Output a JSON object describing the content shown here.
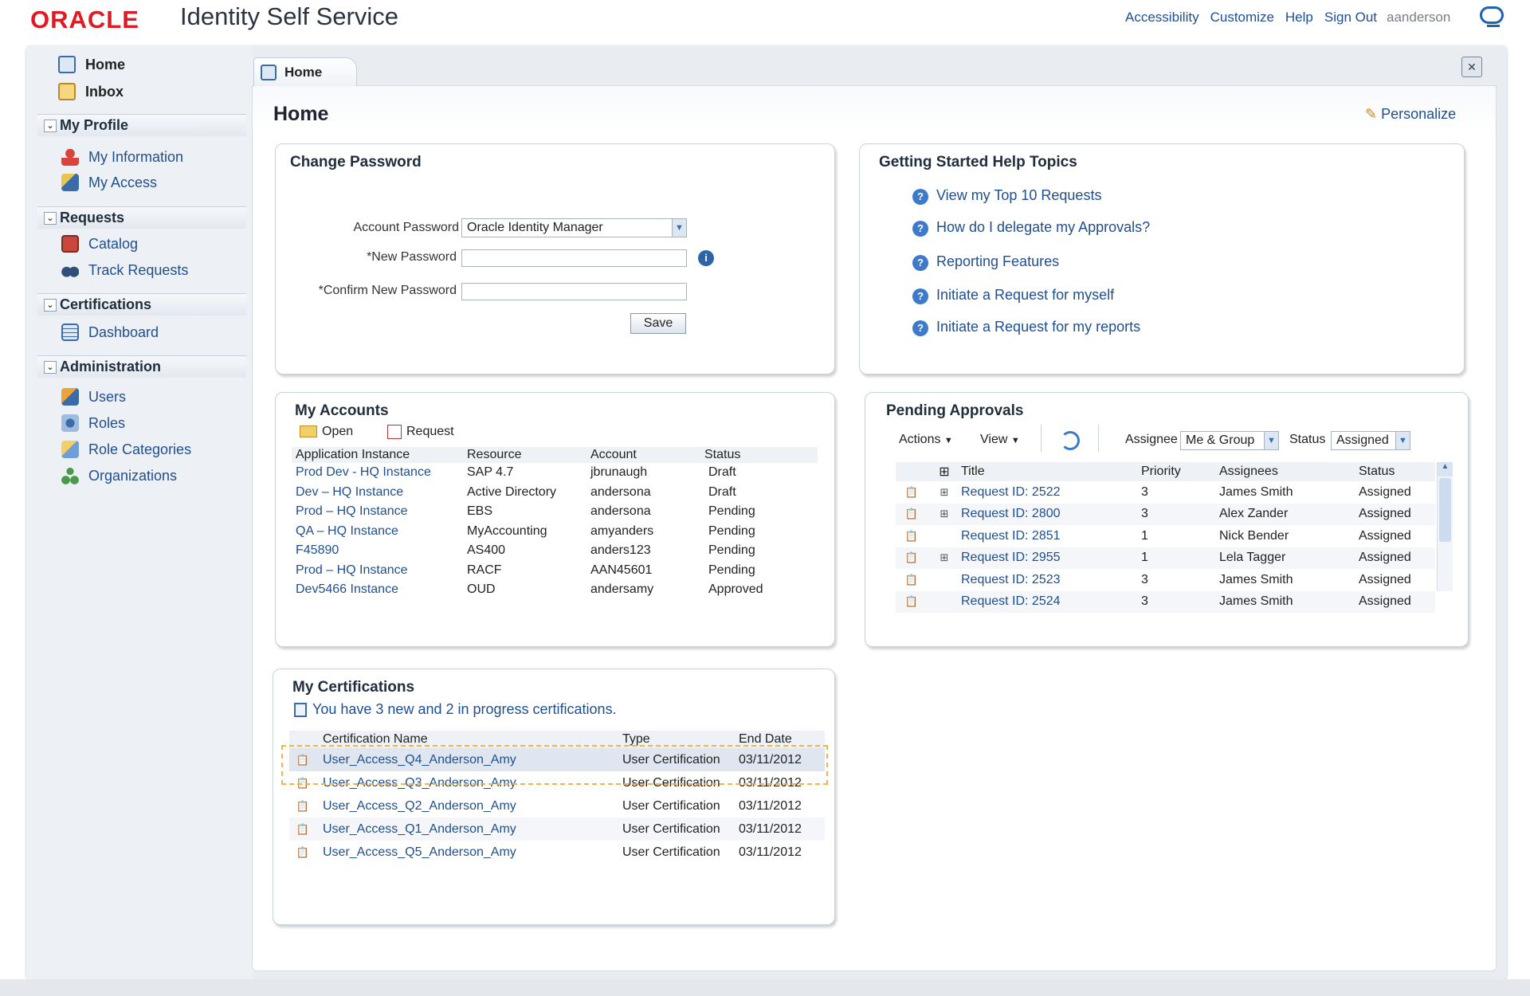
{
  "header": {
    "logo": "ORACLE",
    "app_title": "Identity Self Service",
    "links": [
      "Accessibility",
      "Customize",
      "Help",
      "Sign Out"
    ],
    "username": "aanderson"
  },
  "sidebar": {
    "home": "Home",
    "inbox": "Inbox",
    "sections": [
      {
        "title": "My Profile",
        "items": [
          "My Information",
          "My Access"
        ]
      },
      {
        "title": "Requests",
        "items": [
          "Catalog",
          "Track Requests"
        ]
      },
      {
        "title": "Certifications",
        "items": [
          "Dashboard"
        ]
      },
      {
        "title": "Administration",
        "items": [
          "Users",
          "Roles",
          "Role Categories",
          "Organizations"
        ]
      }
    ]
  },
  "tab": {
    "label": "Home"
  },
  "page": {
    "title": "Home",
    "personalize": "Personalize"
  },
  "change_password": {
    "title": "Change Password",
    "account_label": "Account Password",
    "account_value": "Oracle Identity Manager",
    "new_label": "*New Password",
    "confirm_label": "*Confirm New Password",
    "save": "Save"
  },
  "help_topics": {
    "title": "Getting Started Help Topics",
    "items": [
      "View my Top 10 Requests",
      "How do I delegate my Approvals?",
      "Reporting Features",
      "Initiate a Request for myself",
      "Initiate a Request for my reports"
    ]
  },
  "accounts": {
    "title": "My Accounts",
    "open": "Open",
    "request": "Request",
    "columns": [
      "Application Instance",
      "Resource",
      "Account",
      "Status"
    ],
    "rows": [
      [
        "Prod Dev - HQ Instance",
        "SAP 4.7",
        "jbrunaugh",
        "Draft"
      ],
      [
        "Dev – HQ Instance",
        "Active Directory",
        "andersona",
        "Draft"
      ],
      [
        "Prod – HQ Instance",
        "EBS",
        "andersona",
        "Pending"
      ],
      [
        "QA – HQ Instance",
        "MyAccounting",
        "amyanders",
        "Pending"
      ],
      [
        "F45890",
        "AS400",
        "anders123",
        "Pending"
      ],
      [
        "Prod – HQ Instance",
        "RACF",
        "AAN45601",
        "Pending"
      ],
      [
        "Dev5466 Instance",
        "OUD",
        "andersamy",
        "Approved"
      ]
    ]
  },
  "approvals": {
    "title": "Pending Approvals",
    "actions": "Actions",
    "view": "View",
    "assignee_label": "Assignee",
    "assignee_value": "Me & Group",
    "status_label": "Status",
    "status_value": "Assigned",
    "columns": [
      "Title",
      "Priority",
      "Assignees",
      "Status"
    ],
    "rows": [
      [
        "Request ID: 2522",
        "3",
        "James Smith",
        "Assigned"
      ],
      [
        "Request ID: 2800",
        "3",
        "Alex Zander",
        "Assigned"
      ],
      [
        "Request ID: 2851",
        "1",
        "Nick Bender",
        "Assigned"
      ],
      [
        "Request ID: 2955",
        "1",
        "Lela Tagger",
        "Assigned"
      ],
      [
        "Request ID: 2523",
        "3",
        "James Smith",
        "Assigned"
      ],
      [
        "Request ID: 2524",
        "3",
        "James Smith",
        "Assigned"
      ]
    ]
  },
  "certifications": {
    "title": "My Certifications",
    "message": "You have 3 new and 2 in progress certifications.",
    "columns": [
      "Certification Name",
      "Type",
      "End Date"
    ],
    "rows": [
      [
        "User_Access_Q4_Anderson_Amy",
        "User Certification",
        "03/11/2012"
      ],
      [
        "User_Access_Q3_Anderson_Amy",
        "User Certification",
        "03/11/2012"
      ],
      [
        "User_Access_Q2_Anderson_Amy",
        "User Certification",
        "03/11/2012"
      ],
      [
        "User_Access_Q1_Anderson_Amy",
        "User Certification",
        "03/11/2012"
      ],
      [
        "User_Access_Q5_Anderson_Amy",
        "User Certification",
        "03/11/2012"
      ]
    ]
  }
}
